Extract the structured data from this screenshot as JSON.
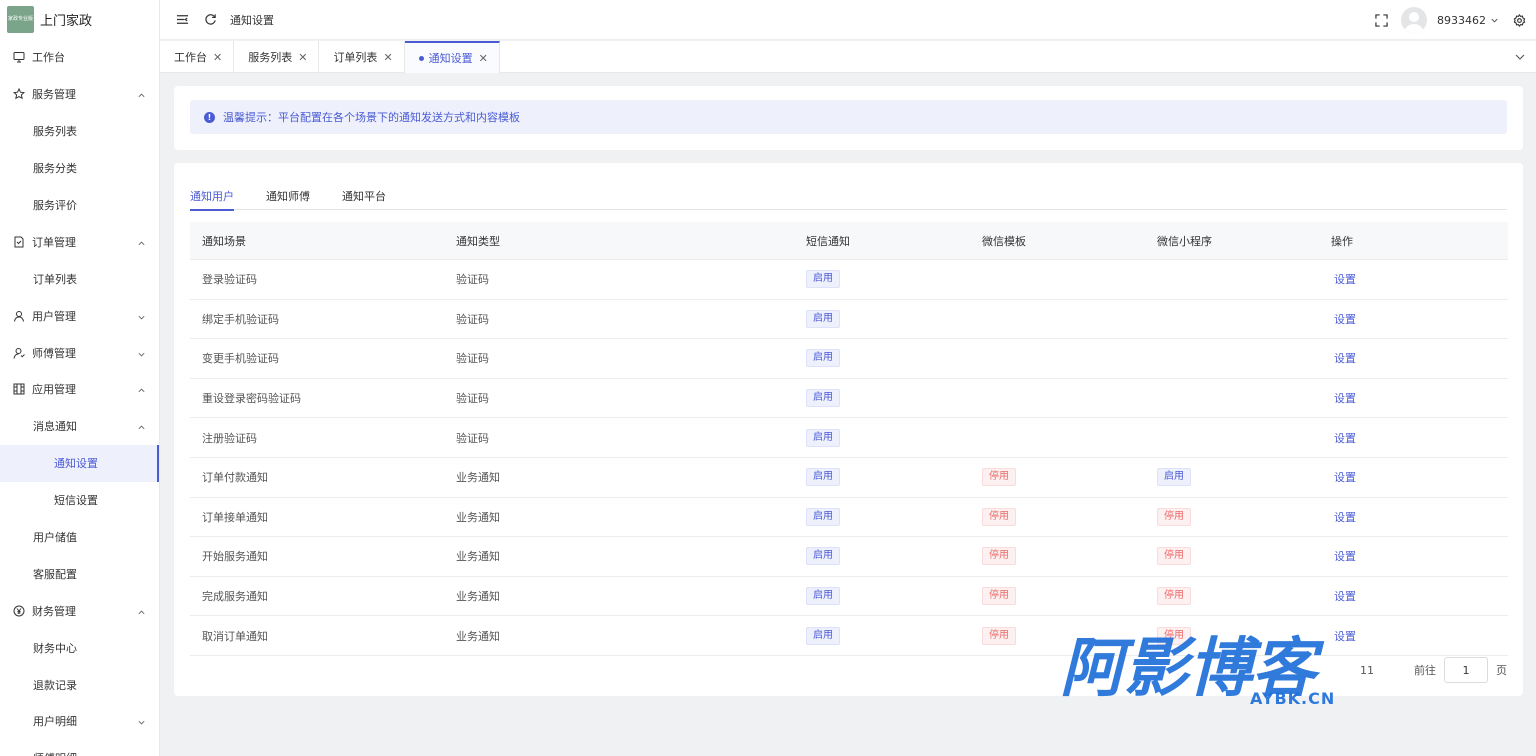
{
  "app": {
    "logo_text": "上门家政",
    "logo_badge_line1": "家政",
    "logo_badge_line2": "专业版"
  },
  "sidebar": {
    "items": [
      {
        "label": "工作台",
        "icon": "monitor-icon",
        "level": 1
      },
      {
        "label": "服务管理",
        "icon": "star-icon",
        "level": 1,
        "expanded": true
      },
      {
        "label": "服务列表",
        "level": 2
      },
      {
        "label": "服务分类",
        "level": 2
      },
      {
        "label": "服务评价",
        "level": 2
      },
      {
        "label": "订单管理",
        "icon": "document-icon",
        "level": 1,
        "expanded": true
      },
      {
        "label": "订单列表",
        "level": 2
      },
      {
        "label": "用户管理",
        "icon": "user-icon",
        "level": 1,
        "expanded": false
      },
      {
        "label": "师傅管理",
        "icon": "worker-icon",
        "level": 1,
        "expanded": false
      },
      {
        "label": "应用管理",
        "icon": "grid-icon",
        "level": 1,
        "expanded": true
      },
      {
        "label": "消息通知",
        "level": 2,
        "expanded": true
      },
      {
        "label": "通知设置",
        "level": 3,
        "active": true
      },
      {
        "label": "短信设置",
        "level": 3
      },
      {
        "label": "用户储值",
        "level": 2
      },
      {
        "label": "客服配置",
        "level": 2
      },
      {
        "label": "财务管理",
        "icon": "yen-icon",
        "level": 1,
        "expanded": true
      },
      {
        "label": "财务中心",
        "level": 2
      },
      {
        "label": "退款记录",
        "level": 2
      },
      {
        "label": "用户明细",
        "level": 2,
        "expanded": false
      },
      {
        "label": "师傅明细",
        "level": 2
      }
    ]
  },
  "header": {
    "breadcrumb": "通知设置",
    "username": "8933462"
  },
  "tabs": [
    {
      "label": "工作台"
    },
    {
      "label": "服务列表"
    },
    {
      "label": "订单列表"
    },
    {
      "label": "通知设置",
      "active": true
    }
  ],
  "alert": {
    "text": "温馨提示：平台配置在各个场景下的通知发送方式和内容模板"
  },
  "subtabs": [
    {
      "label": "通知用户",
      "active": true
    },
    {
      "label": "通知师傅"
    },
    {
      "label": "通知平台"
    }
  ],
  "table": {
    "headers": [
      "通知场景",
      "通知类型",
      "短信通知",
      "微信模板",
      "微信小程序",
      "操作"
    ],
    "rows": [
      {
        "scene": "登录验证码",
        "type": "验证码",
        "sms": "启用",
        "wx": "",
        "mini": "",
        "action": "设置"
      },
      {
        "scene": "绑定手机验证码",
        "type": "验证码",
        "sms": "启用",
        "wx": "",
        "mini": "",
        "action": "设置"
      },
      {
        "scene": "变更手机验证码",
        "type": "验证码",
        "sms": "启用",
        "wx": "",
        "mini": "",
        "action": "设置"
      },
      {
        "scene": "重设登录密码验证码",
        "type": "验证码",
        "sms": "启用",
        "wx": "",
        "mini": "",
        "action": "设置"
      },
      {
        "scene": "注册验证码",
        "type": "验证码",
        "sms": "启用",
        "wx": "",
        "mini": "",
        "action": "设置"
      },
      {
        "scene": "订单付款通知",
        "type": "业务通知",
        "sms": "启用",
        "wx": "停用",
        "mini": "启用",
        "action": "设置"
      },
      {
        "scene": "订单接单通知",
        "type": "业务通知",
        "sms": "启用",
        "wx": "停用",
        "mini": "停用",
        "action": "设置"
      },
      {
        "scene": "开始服务通知",
        "type": "业务通知",
        "sms": "启用",
        "wx": "停用",
        "mini": "停用",
        "action": "设置"
      },
      {
        "scene": "完成服务通知",
        "type": "业务通知",
        "sms": "启用",
        "wx": "停用",
        "mini": "停用",
        "action": "设置"
      },
      {
        "scene": "取消订单通知",
        "type": "业务通知",
        "sms": "启用",
        "wx": "停用",
        "mini": "停用",
        "action": "设置"
      }
    ]
  },
  "pager": {
    "total": "11",
    "goto_label": "前往",
    "page": "1",
    "page_suffix": "页"
  },
  "watermark": {
    "big": "阿影博客",
    "small": "AYBK.CN"
  },
  "colors": {
    "accent": "#4a5bd4",
    "danger": "#ee6a6a"
  }
}
